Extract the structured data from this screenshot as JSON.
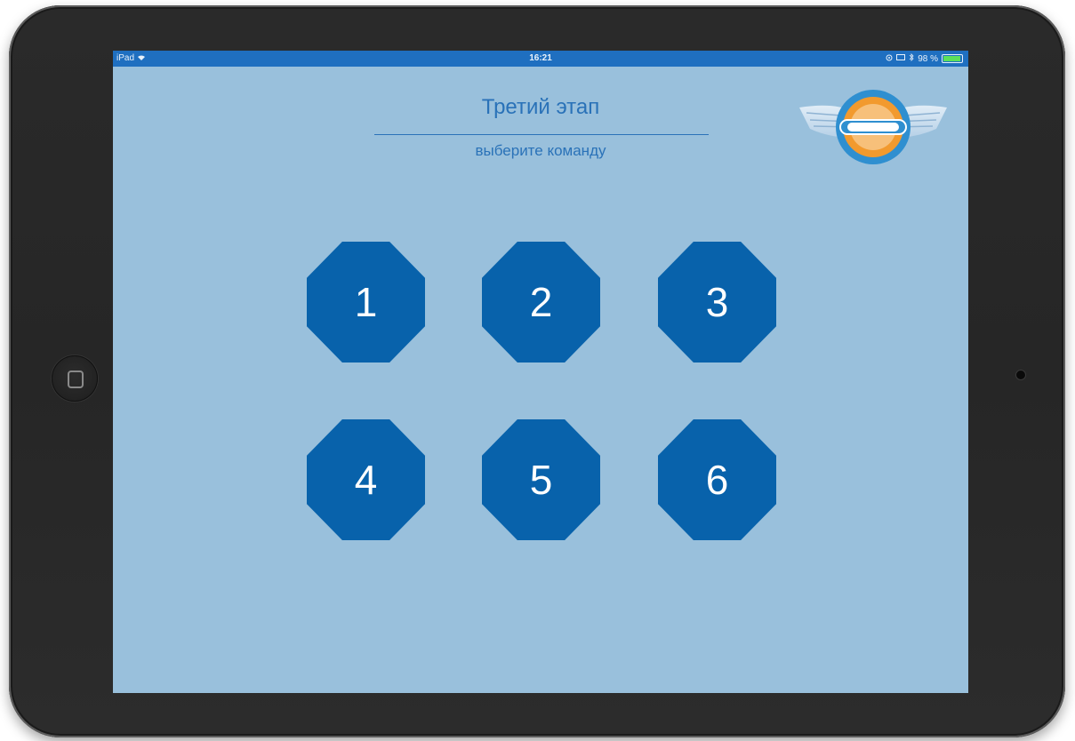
{
  "status_bar": {
    "device": "iPad",
    "wifi_icon": "wifi-icon",
    "time": "16:21",
    "battery_percent": "98 %",
    "icons": [
      "location-icon",
      "screen-mirror-icon",
      "bluetooth-icon",
      "battery-icon"
    ],
    "bar_color": "#1f6fc0"
  },
  "header": {
    "title": "Третий этап",
    "subtitle": "выберите команду"
  },
  "logo": {
    "icon": "winged-emblem-logo"
  },
  "teams": [
    {
      "label": "1"
    },
    {
      "label": "2"
    },
    {
      "label": "3"
    },
    {
      "label": "4"
    },
    {
      "label": "5"
    },
    {
      "label": "6"
    }
  ],
  "colors": {
    "background": "#99c0dc",
    "accent": "#2a72b8",
    "button": "#0862ab"
  }
}
